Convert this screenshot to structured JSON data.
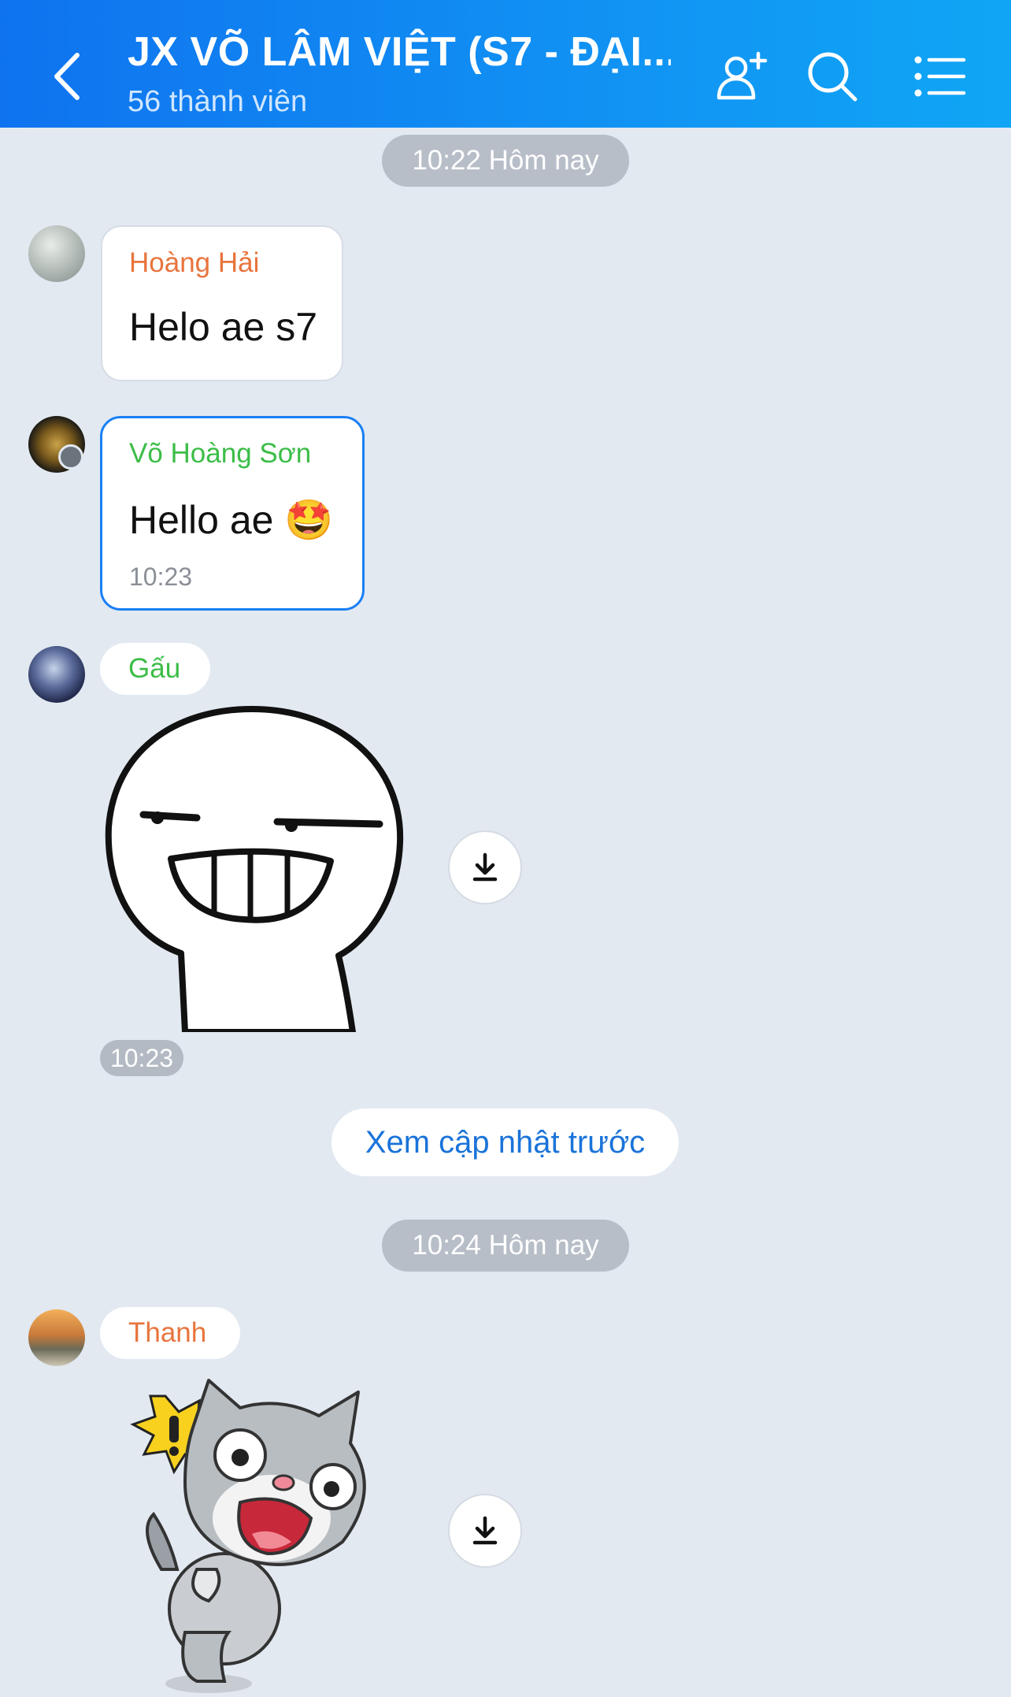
{
  "header": {
    "title": "JX VÕ LÂM VIỆT (S7 - ĐẠI...",
    "subtitle": "56 thành viên",
    "icons": [
      "back-icon",
      "add-member-icon",
      "search-icon",
      "menu-list-icon"
    ]
  },
  "timestamps": {
    "first": "10:22 Hôm nay",
    "second": "10:24 Hôm nay"
  },
  "messages": [
    {
      "sender": "Hoàng Hải",
      "sender_color": "#e8743c",
      "text": "Helo ae s7"
    },
    {
      "sender": "Võ Hoàng Sơn",
      "sender_color": "#3cbd48",
      "text": "Hello ae 🤩",
      "time": "10:23"
    },
    {
      "sender": "Gấu",
      "sender_color": "#3cbd48",
      "sticker": "grinning-face-sticker",
      "time": "10:23"
    },
    {
      "sender": "Thanh",
      "sender_color": "#e8743c",
      "sticker": "scared-cat-sticker"
    }
  ],
  "load_more": "Xem cập nhật trước",
  "colors": {
    "accent": "#0f73ef",
    "background": "#e2e9f1"
  }
}
